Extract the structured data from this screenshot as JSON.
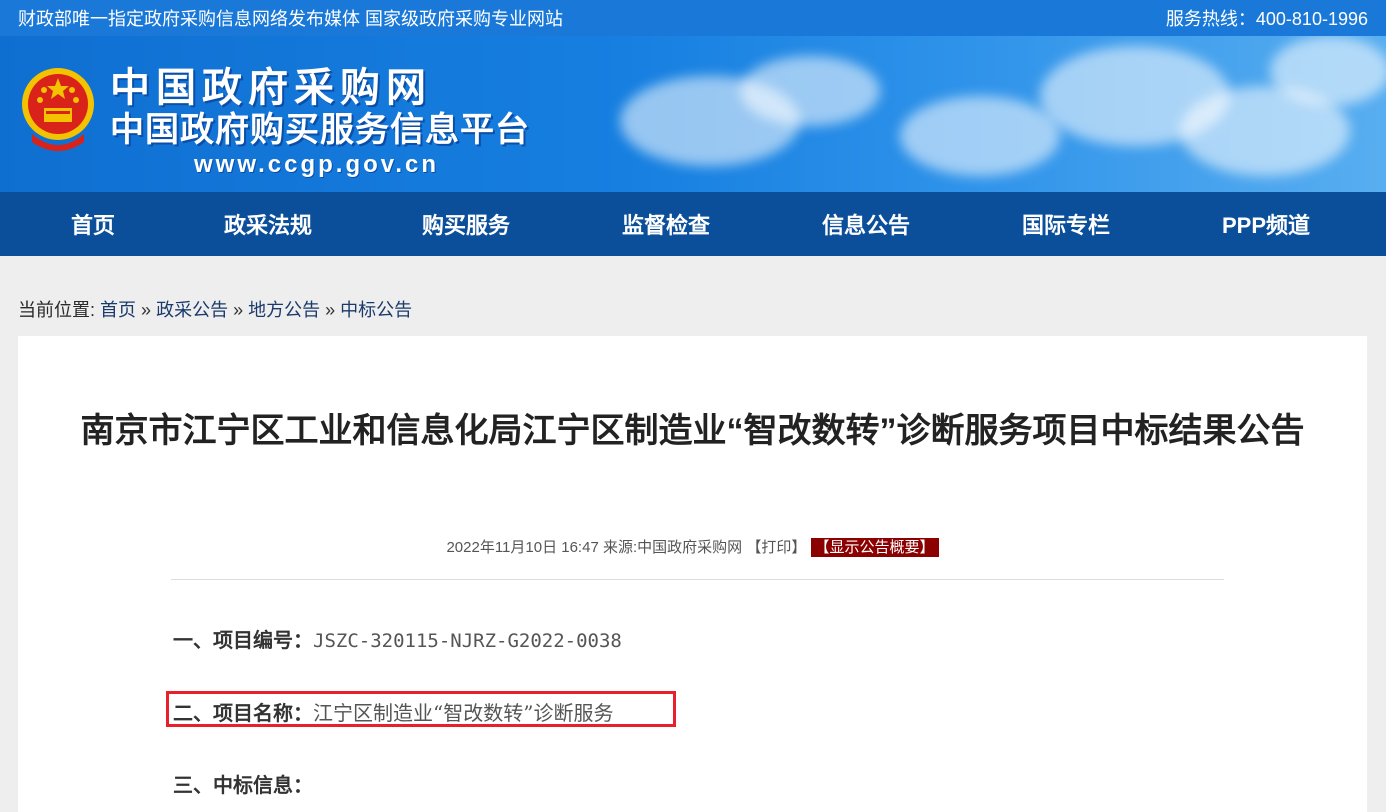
{
  "topbar": {
    "left": "财政部唯一指定政府采购信息网络发布媒体 国家级政府采购专业网站",
    "right": "服务热线：400-810-1996"
  },
  "logo": {
    "line1": "中国政府采购网",
    "line2": "中国政府购买服务信息平台",
    "line3": "www.ccgp.gov.cn"
  },
  "nav": [
    "首页",
    "政采法规",
    "购买服务",
    "监督检查",
    "信息公告",
    "国际专栏",
    "PPP频道"
  ],
  "breadcrumb": {
    "prefix": "当前位置:",
    "items": [
      "首页",
      "政采公告",
      "地方公告",
      "中标公告"
    ],
    "sep": "»"
  },
  "article": {
    "title": "南京市江宁区工业和信息化局江宁区制造业“智改数转”诊断服务项目中标结果公告",
    "date": "2022年11月10日 16:47",
    "source_label": "来源:",
    "source": "中国政府采购网",
    "print": "【打印】",
    "summary": "【显示公告概要】",
    "sections": [
      {
        "label": "一、项目编号：",
        "value": "JSZC-320115-NJRZ-G2022-0038"
      },
      {
        "label": "二、项目名称：",
        "value": "江宁区制造业“智改数转”诊断服务"
      },
      {
        "label": "三、中标信息：",
        "value": ""
      }
    ]
  },
  "colors": {
    "topbar": "#1a79d8",
    "nav": "#0b4f9b",
    "highlight": "#e8202c",
    "summary_tag": "#8b0000"
  }
}
